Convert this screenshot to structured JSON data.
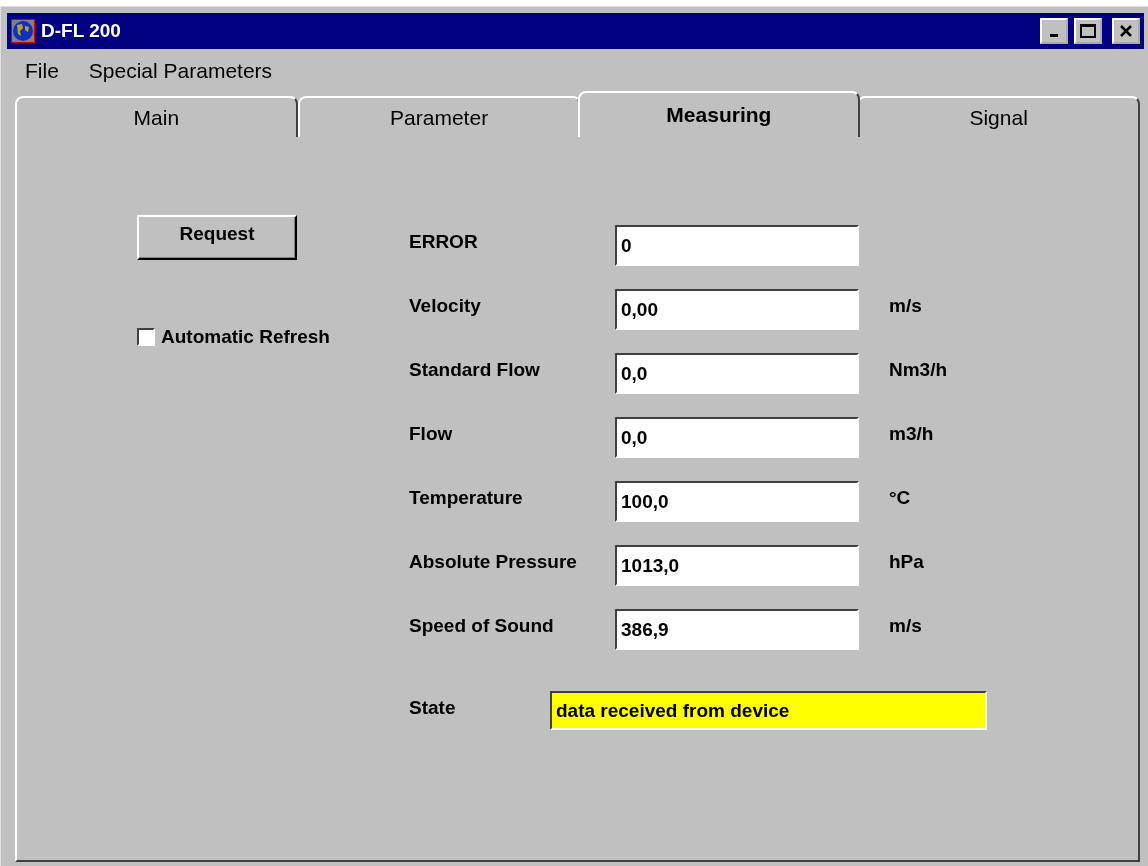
{
  "window": {
    "title": "D-FL 200"
  },
  "menu": [
    "File",
    "Special Parameters"
  ],
  "tabs": [
    {
      "label": "Main",
      "selected": false
    },
    {
      "label": "Parameter",
      "selected": false
    },
    {
      "label": "Measuring",
      "selected": true
    },
    {
      "label": "Signal",
      "selected": false
    }
  ],
  "request_button": "Request",
  "automatic_refresh": {
    "label": "Automatic Refresh",
    "checked": false
  },
  "measurements": [
    {
      "label": "ERROR",
      "value": "0"
    },
    {
      "label": "Velocity",
      "value": "0,00",
      "unit": "m/s"
    },
    {
      "label": "Standard Flow",
      "value": "0,0",
      "unit": "Nm3/h"
    },
    {
      "label": "Flow",
      "value": "0,0",
      "unit": "m3/h"
    },
    {
      "label": "Temperature",
      "value": "100,0",
      "unit": "°C"
    },
    {
      "label": "Absolute Pressure",
      "value": "1013,0",
      "unit": "hPa"
    },
    {
      "label": "Speed of Sound",
      "value": "386,9",
      "unit": "m/s"
    }
  ],
  "state": {
    "label": "State",
    "value": "data received from device"
  }
}
